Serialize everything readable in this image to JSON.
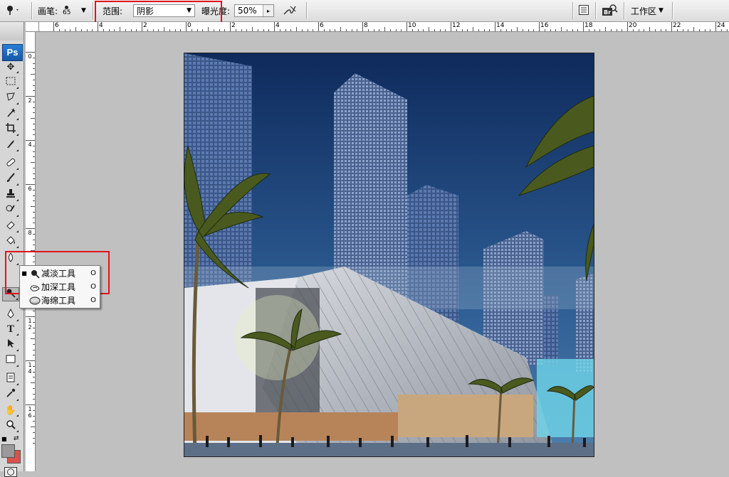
{
  "options_bar": {
    "brush_label": "画笔:",
    "brush_size": "65",
    "range_label": "范围:",
    "range_value": "阴影",
    "exposure_label": "曝光度:",
    "exposure_value": "50%",
    "workspace_label": "工作区"
  },
  "toolbox": {
    "logo": "Ps",
    "tools": [
      "move",
      "marquee",
      "lasso",
      "magic-wand",
      "crop",
      "slice",
      "healing",
      "brush",
      "clone-stamp",
      "history-brush",
      "eraser",
      "paint-bucket",
      "blur",
      "dodge",
      "pen",
      "type",
      "path-selection",
      "shape",
      "notes",
      "eyedropper",
      "hand",
      "zoom"
    ]
  },
  "flyout": {
    "items": [
      {
        "label": "减淡工具",
        "key": "O",
        "selected": true
      },
      {
        "label": "加深工具",
        "key": "O",
        "selected": false
      },
      {
        "label": "海绵工具",
        "key": "O",
        "selected": false
      }
    ]
  },
  "ruler": {
    "top_labels": [
      "6",
      "4",
      "2",
      "0",
      "2",
      "4",
      "6",
      "8",
      "10",
      "12",
      "14",
      "16",
      "18",
      "20",
      "22",
      "24"
    ],
    "left_labels": [
      "0",
      "2",
      "4",
      "6",
      "8",
      "1\n0",
      "1\n2",
      "1\n4",
      "1\n6"
    ]
  },
  "colors": {
    "highlight_box": "#e0141c",
    "foreground": "#9a9a9a",
    "background": "#d9534a"
  }
}
